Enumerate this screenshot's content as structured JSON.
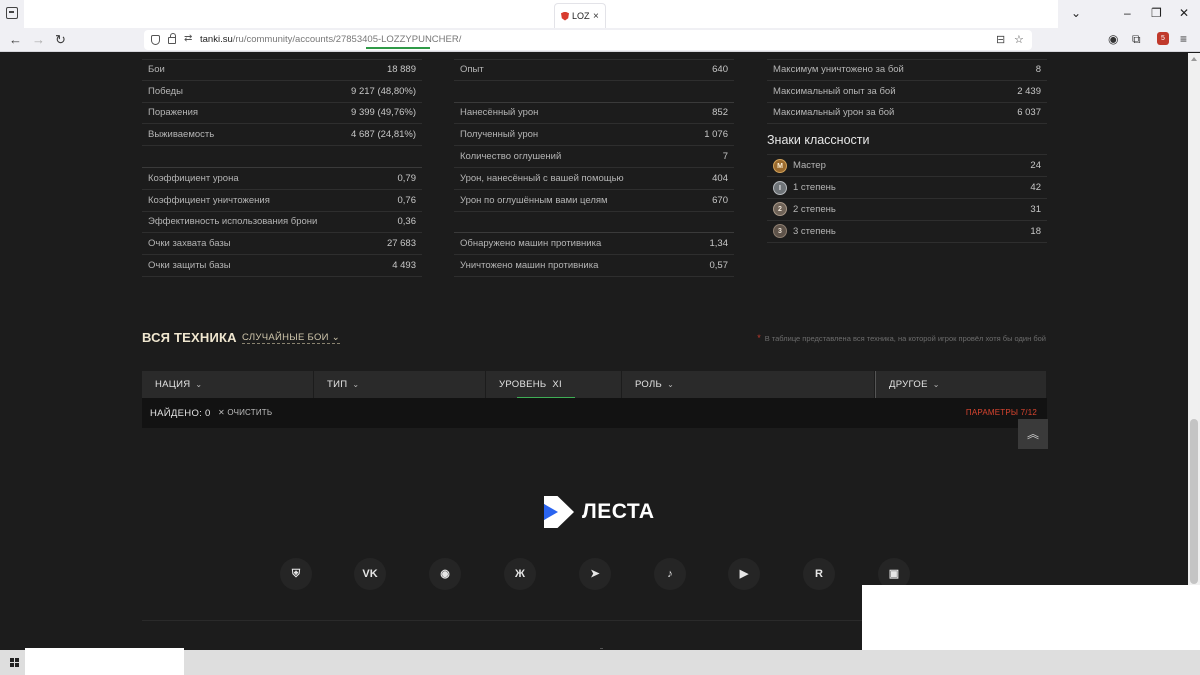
{
  "browser": {
    "tab_title": "LOZZ",
    "tab_close": "×",
    "url_host": "tanki.su",
    "url_path": "/ru/community/accounts/27853405-LOZZYPUNCHER/",
    "window_controls": [
      "⌄",
      "–",
      "❐",
      "✕"
    ],
    "nav": {
      "back": "←",
      "forward": "→",
      "reload": "↻"
    },
    "ext_badge": "5"
  },
  "stats": {
    "col1": [
      {
        "label": "Бои",
        "value": "18 889"
      },
      {
        "label": "Победы",
        "value": "9 217 (48,80%)"
      },
      {
        "label": "Поражения",
        "value": "9 399 (49,76%)"
      },
      {
        "label": "Выживаемость",
        "value": "4 687 (24,81%)"
      },
      {
        "label": "Коэффициент урона",
        "value": "0,79"
      },
      {
        "label": "Коэффициент уничтожения",
        "value": "0,76"
      },
      {
        "label": "Эффективность использования брони",
        "value": "0,36"
      },
      {
        "label": "Очки захвата базы",
        "value": "27 683"
      },
      {
        "label": "Очки защиты базы",
        "value": "4 493"
      }
    ],
    "col2": [
      {
        "label": "Опыт",
        "value": "640"
      },
      {
        "label": "Нанесённый урон",
        "value": "852"
      },
      {
        "label": "Полученный урон",
        "value": "1 076"
      },
      {
        "label": "Количество оглушений",
        "value": "7"
      },
      {
        "label": "Урон, нанесённый с вашей помощью",
        "value": "404"
      },
      {
        "label": "Урон по оглушённым вами целям",
        "value": "670"
      },
      {
        "label": "Обнаружено машин противника",
        "value": "1,34"
      },
      {
        "label": "Уничтожено машин противника",
        "value": "0,57"
      }
    ],
    "col3": [
      {
        "label": "Максимум уничтожено за бой",
        "value": "8"
      },
      {
        "label": "Максимальный опыт за бой",
        "value": "2 439"
      },
      {
        "label": "Максимальный урон за бой",
        "value": "6 037"
      }
    ],
    "class_marks_title": "Знаки классности",
    "class_marks": [
      {
        "badge": "М",
        "label": "Мастер",
        "value": "24"
      },
      {
        "badge": "I",
        "label": "1 степень",
        "value": "42"
      },
      {
        "badge": "2",
        "label": "2 степень",
        "value": "31"
      },
      {
        "badge": "3",
        "label": "3 степень",
        "value": "18"
      }
    ]
  },
  "vehicles": {
    "title": "ВСЯ ТЕХНИКА",
    "mode": "СЛУЧАЙНЫЕ БОИ",
    "note_star": "*",
    "note": "В таблице представлена вся техника, на которой игрок провёл хотя бы один бой",
    "filters": {
      "nation": "НАЦИЯ",
      "type": "ТИП",
      "level": "УРОВЕНЬ",
      "level_value": "XI",
      "role": "РОЛЬ",
      "other": "ДРУГОЕ"
    },
    "found": "НАЙДЕНО: 0",
    "clear": "ОЧИСТИТЬ",
    "params": "ПАРАМЕТРЫ 7/12"
  },
  "footer": {
    "logo_text": "ЛЕСТА",
    "socials": [
      "lesta-icon",
      "vk-icon",
      "discord-icon",
      "ok-icon",
      "telegram-icon",
      "tiktok-icon",
      "youtube-icon",
      "rutube-icon",
      "twitch-icon"
    ]
  },
  "colors": {
    "background": "#1c1c1c",
    "accent_green": "#3fae55",
    "params_red": "#d9442f",
    "logo_blue": "#2a64f0"
  }
}
